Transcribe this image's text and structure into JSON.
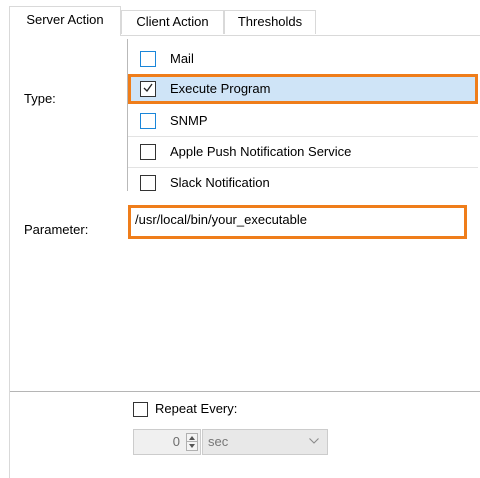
{
  "tabs": [
    {
      "label": "Server Action",
      "active": true
    },
    {
      "label": "Client Action",
      "active": false
    },
    {
      "label": "Thresholds",
      "active": false
    }
  ],
  "type_label": "Type:",
  "type_options": [
    {
      "label": "Mail",
      "checked": false,
      "selected": false,
      "checkbox_color": "#1a86d9"
    },
    {
      "label": "Execute Program",
      "checked": true,
      "selected": true,
      "checkbox_color": "#333333"
    },
    {
      "label": "SNMP",
      "checked": false,
      "selected": false,
      "checkbox_color": "#1a86d9"
    },
    {
      "label": "Apple Push Notification Service",
      "checked": false,
      "selected": false,
      "checkbox_color": "#333333"
    },
    {
      "label": "Slack Notification",
      "checked": false,
      "selected": false,
      "checkbox_color": "#333333"
    }
  ],
  "parameter_label": "Parameter:",
  "parameter_value": "/usr/local/bin/your_executable",
  "repeat": {
    "label": "Repeat Every:",
    "checked": false,
    "interval_value": "0",
    "unit": "sec"
  },
  "colors": {
    "highlight_border": "#ef7d1a",
    "selection_fill": "#cfe4f7",
    "checkbox_blue": "#1a86d9"
  },
  "icons": {
    "spinner": "up-down-spinner-icon",
    "dropdown": "chevron-down-icon",
    "check": "check-mark-icon"
  }
}
